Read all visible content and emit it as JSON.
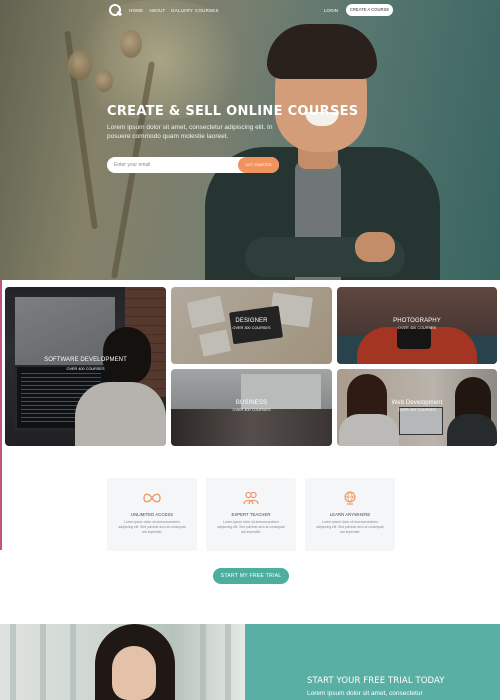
{
  "nav": {
    "links": [
      "HOME",
      "ABOUT",
      "GALLERY",
      "COURSES"
    ],
    "login": "LOGIN",
    "cta": "CREATE A COURSE"
  },
  "hero": {
    "title": "CREATE & SELL ONLINE COURSES",
    "subtitle": "Lorem ipsum dolor sit amet, consectetur adipiscing elit. In posuere commodo quam molestie laoreet.",
    "email_placeholder": "Enter your email",
    "button": "GET STARTED"
  },
  "courses": [
    {
      "title": "SOFTWARE DEVELOPMENT",
      "sub": "OVER 400 COURSES"
    },
    {
      "title": "DESIGNER",
      "sub": "OVER 300 COURSES"
    },
    {
      "title": "PHOTOGRAPHY",
      "sub": "OVER 400 COURSES"
    },
    {
      "title": "BUSINESS",
      "sub": "OVER 400 COURSES"
    },
    {
      "title": "Web Development",
      "sub": "OVER 400 COURSES"
    }
  ],
  "features": [
    {
      "icon": "infinity-icon",
      "title": "UNLIMITED ACCESS",
      "desc": "Lorem ipsum dolor sit ameconsectetur adipiscing elit. Sed pulvinar arcu at consequat nisi imperdiet."
    },
    {
      "icon": "users-icon",
      "title": "EXPERT TEACHER",
      "desc": "Lorem ipsum dolor sit ameconsectetur adipiscing elit. Sed pulvinar arcu at consequat nisi imperdiet."
    },
    {
      "icon": "globe-icon",
      "title": "LEARN ANYWHERE",
      "desc": "Lorem ipsum dolor sit ameconsectetur adipiscing elit. Sed pulvinar arcu at consequat nisi imperdiet."
    }
  ],
  "trial_button": "START MY FREE TRIAL",
  "bottom": {
    "title": "START YOUR FREE TRIAL TODAY",
    "subtitle": "Lorem ipsum dolor sit amet, consectetur"
  },
  "colors": {
    "accent_orange": "#f0935e",
    "accent_teal": "#4daea0",
    "teal_panel": "#5aafa5"
  }
}
